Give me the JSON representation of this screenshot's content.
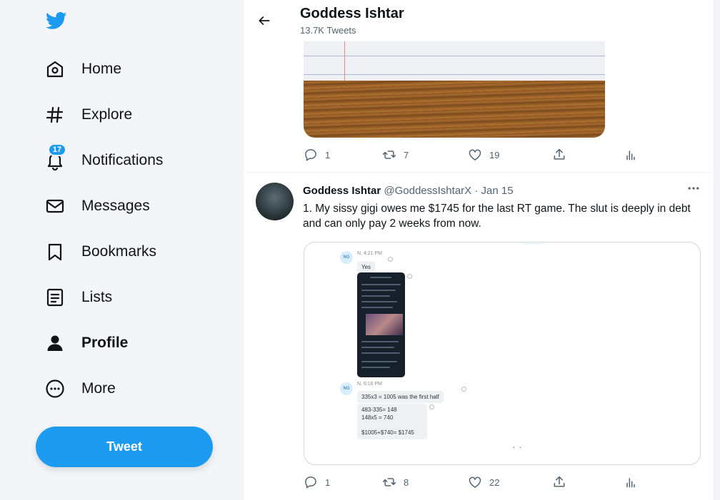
{
  "sidebar": {
    "logo_icon": "twitter-bird-icon",
    "brand_color": "#1d9bf0",
    "items": [
      {
        "label": "Home",
        "icon": "home-icon"
      },
      {
        "label": "Explore",
        "icon": "hashtag-icon"
      },
      {
        "label": "Notifications",
        "icon": "bell-icon",
        "badge": "17"
      },
      {
        "label": "Messages",
        "icon": "envelope-icon"
      },
      {
        "label": "Bookmarks",
        "icon": "bookmark-icon"
      },
      {
        "label": "Lists",
        "icon": "list-icon"
      },
      {
        "label": "Profile",
        "icon": "person-icon",
        "active": true
      },
      {
        "label": "More",
        "icon": "more-circle-icon"
      }
    ],
    "tweet_button": "Tweet"
  },
  "header": {
    "title": "Goddess Ishtar",
    "subtitle": "13.7K Tweets"
  },
  "previous_tweet": {
    "actions": {
      "replies": "1",
      "retweets": "7",
      "likes": "19"
    }
  },
  "tweet": {
    "name": "Goddess Ishtar",
    "handle": "@GoddessIshtarX",
    "separator": "·",
    "date": "Jan 15",
    "text": "1. My sissy gigi owes me $1745 for the last RT game. The slut is deeply in debt and can only pay 2 weeks from now.",
    "actions": {
      "replies": "1",
      "retweets": "8",
      "likes": "22"
    },
    "media": {
      "msg1": {
        "avatar": "NG",
        "meta": "N, 4:21 PM",
        "text": "Yes"
      },
      "msg2": {
        "avatar": "NG",
        "meta": "N, 6:16 PM",
        "line1": "335x3 = 1005 was the first half",
        "line2": "483-335= 148",
        "line3": "148x5 = 740",
        "line4": "$1005+$740= $1745"
      }
    }
  }
}
